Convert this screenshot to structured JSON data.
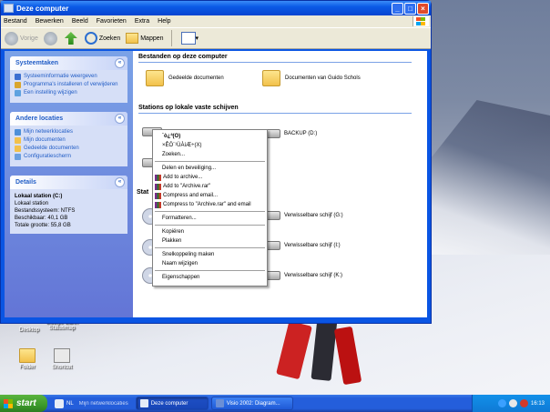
{
  "window": {
    "title": "Deze computer",
    "menu": [
      "Bestand",
      "Bewerken",
      "Beeld",
      "Favorieten",
      "Extra",
      "Help"
    ],
    "toolbar": {
      "back": "Vorige",
      "search": "Zoeken",
      "folders": "Mappen"
    }
  },
  "taskpane": {
    "system": {
      "title": "Systeemtaken",
      "links": [
        "Systeeminformatie weergeven",
        "Programma's installeren of verwijderen",
        "Een instelling wijzigen"
      ]
    },
    "places": {
      "title": "Andere locaties",
      "links": [
        "Mijn netwerklocaties",
        "Mijn documenten",
        "Gedeelde documenten",
        "Configuratiescherm"
      ]
    },
    "details": {
      "title": "Details",
      "name": "Lokaal station (C:)",
      "type": "Lokaal station",
      "fs": "Bestandssysteem: NTFS",
      "free": "Beschikbaar: 40,1 GB",
      "total": "Totale grootte: 55,8 GB"
    }
  },
  "main": {
    "files_header": "Bestanden op deze computer",
    "shared_docs": "Gedeelde documenten",
    "user_docs": "Documenten van Guido Schols",
    "drives_header": "Stations op lokale vaste schijven",
    "backup": "BACKUP (D:)",
    "removable_header": "Stat",
    "removable": [
      "Verwisselbare schijf (G:)",
      "Verwisselbare schijf (I:)",
      "Verwisselbare schijf (K:)"
    ]
  },
  "context_menu": {
    "open": "´ò¿ª(O)",
    "explore": "×ÊÔ´¹ÜÀíÆ÷(X)",
    "search": "Zoeken...",
    "sharing": "Delen en beveiliging...",
    "rar": [
      "Add to archive...",
      "Add to \"Archive.rar\"",
      "Compress and email...",
      "Compress to \"Archive.rar\" and email"
    ],
    "format": "Formatteren...",
    "copy": "Kopiëren",
    "paste": "Plakken",
    "shortcut": "Snelkoppeling maken",
    "rename": "Naam wijzigen",
    "properties": "Eigenschappen"
  },
  "desktop": {
    "icon1": "Desktop",
    "icon2": "Google Earth",
    "icon2b": "Statusmap",
    "icon3": "Folder",
    "icon4": "Shortcut"
  },
  "taskbar": {
    "start": "start",
    "lang": "NL",
    "quick": "Mijn netwerklocaties",
    "tasks": [
      "Deze computer",
      "Visio 2002: Diagram..."
    ],
    "clock": "16:13"
  }
}
